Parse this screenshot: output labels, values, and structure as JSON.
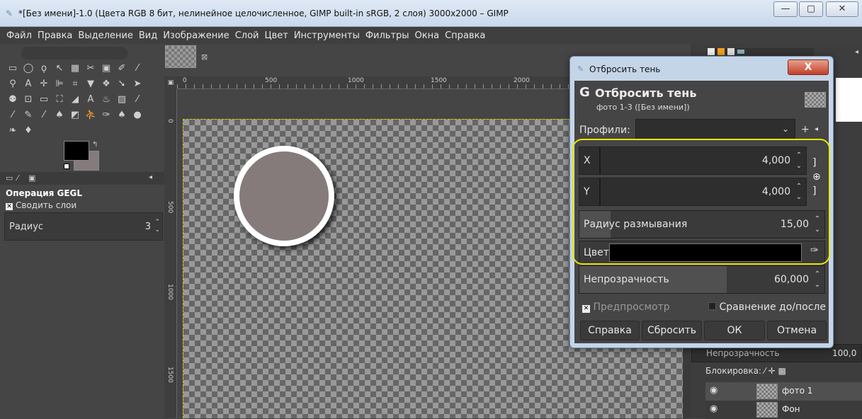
{
  "window": {
    "title": "*[Без имени]-1.0 (Цвета RGB 8 бит, нелинейное целочисленное, GIMP built-in sRGB, 2 слоя) 3000x2000 – GIMP",
    "minimize": "—",
    "maximize": "▢",
    "close": "✕"
  },
  "menu": [
    "Файл",
    "Правка",
    "Выделение",
    "Вид",
    "Изображение",
    "Слой",
    "Цвет",
    "Инструменты",
    "Фильтры",
    "Окна",
    "Справка"
  ],
  "toolbox": {
    "gegl_title": "Операция GEGL",
    "merge_layers": "Сводить слои",
    "radius_label": "Радиус",
    "radius_value": "3"
  },
  "ruler": {
    "h_ticks": [
      "0",
      "500",
      "1000",
      "1500",
      "2000"
    ],
    "v_ticks": [
      "0",
      "500",
      "1000",
      "1500"
    ]
  },
  "dialog": {
    "window_title": "Отбросить тень",
    "close": "X",
    "heading": "Отбросить тень",
    "subheading": "фото 1-3 ([Без имени])",
    "profiles_label": "Профили:",
    "x_label": "X",
    "x_value": "4,000",
    "y_label": "Y",
    "y_value": "4,000",
    "blur_label": "Радиус размывания",
    "blur_value": "15,00",
    "color_label": "Цвет",
    "color_value": "#000000",
    "opacity_label": "Непрозрачность",
    "opacity_value": "60,000",
    "preview_label": "Предпросмотр",
    "compare_label": "Сравнение до/после",
    "btn_help": "Справка",
    "btn_reset": "Сбросить",
    "btn_ok": "ОК",
    "btn_cancel": "Отмена"
  },
  "layers": {
    "opacity_label": "Непрозрачность",
    "opacity_value": "100,0",
    "lock_label": "Блокировка:",
    "items": [
      {
        "name": "фото 1"
      },
      {
        "name": "Фон"
      }
    ]
  },
  "colors": {
    "foreground": "#000000",
    "background": "#857b7b",
    "highlight": "#e6e600"
  }
}
